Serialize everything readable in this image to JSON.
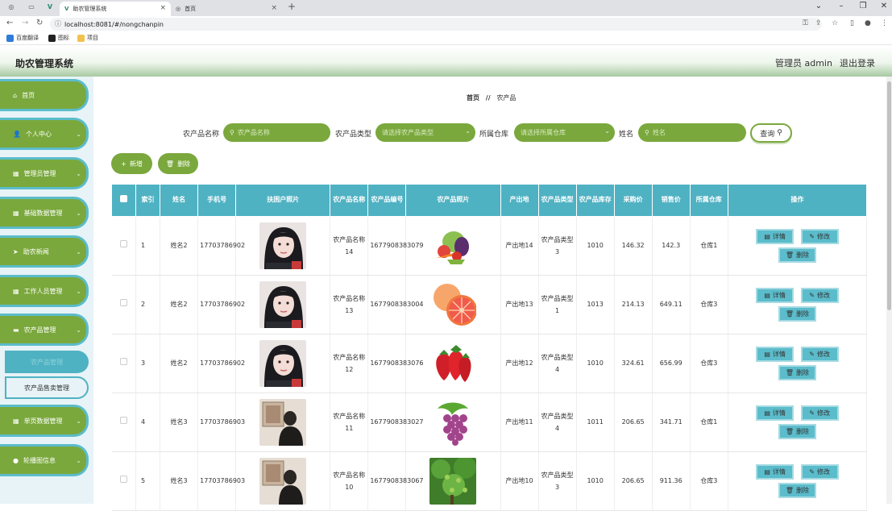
{
  "browser": {
    "tabs": [
      {
        "title": "助农管理系统",
        "active": true
      },
      {
        "title": "首页",
        "active": false
      }
    ],
    "new_tab_icon": "plus-icon",
    "url": "localhost:8081/#/nongchanpin",
    "bookmarks": [
      {
        "label": "百度翻译",
        "color": "#2f7bd9"
      },
      {
        "label": "图标",
        "color": "#222222"
      },
      {
        "label": "项目",
        "color": "#f2c14e"
      }
    ]
  },
  "header": {
    "title": "助农管理系统",
    "user": "管理员 admin",
    "logout": "退出登录"
  },
  "sidebar": {
    "items": [
      {
        "label": "首页",
        "icon": "home-icon",
        "chevron": false
      },
      {
        "label": "个人中心",
        "icon": "user-icon",
        "chevron": true
      },
      {
        "label": "管理员管理",
        "icon": "grid-icon",
        "chevron": true
      },
      {
        "label": "基础数据管理",
        "icon": "grid-icon",
        "chevron": true
      },
      {
        "label": "助农新闻",
        "icon": "send-icon",
        "chevron": true
      },
      {
        "label": "工作人员管理",
        "icon": "grid-icon",
        "chevron": true
      },
      {
        "label": "农产品管理",
        "icon": "briefcase-icon",
        "chevron": true
      },
      {
        "label": "单页数据管理",
        "icon": "grid-icon",
        "chevron": true
      },
      {
        "label": "轮播图信息",
        "icon": "pin-icon",
        "chevron": true
      }
    ],
    "subitems": [
      {
        "label": "农产品管理"
      },
      {
        "label": "农产品售卖管理"
      }
    ]
  },
  "breadcrumb": {
    "home": "首页",
    "separator": "//",
    "current": "农产品"
  },
  "filters": {
    "name_label": "农产品名称",
    "name_placeholder": "农产品名称",
    "type_label": "农产品类型",
    "type_placeholder": "请选择农产品类型",
    "warehouse_label": "所属仓库",
    "warehouse_placeholder": "请选择所属仓库",
    "person_label": "姓名",
    "person_placeholder": "姓名",
    "search_label": "查询"
  },
  "actions": {
    "add": "新增",
    "delete": "删除"
  },
  "table": {
    "headers": [
      "",
      "索引",
      "姓名",
      "手机号",
      "扶困户照片",
      "农产品名称",
      "农产品编号",
      "农产品照片",
      "产出地",
      "农产品类型",
      "农产品库存",
      "采购价",
      "销售价",
      "所属仓库",
      "操作"
    ],
    "row_buttons": {
      "detail": "详情",
      "edit": "修改",
      "delete": "删除"
    },
    "rows": [
      {
        "index": "1",
        "name": "姓名2",
        "phone": "17703786902",
        "person_photo": "woman",
        "product": "农产品名称14",
        "code": "1677908383079",
        "product_photo": "vegetables",
        "origin": "产出地14",
        "type": "农产品类型3",
        "stock": "1010",
        "buy": "146.32",
        "sell": "142.3",
        "warehouse": "仓库1"
      },
      {
        "index": "2",
        "name": "姓名2",
        "phone": "17703786902",
        "person_photo": "woman",
        "product": "农产品名称13",
        "code": "1677908383004",
        "product_photo": "grapefruit",
        "origin": "产出地13",
        "type": "农产品类型1",
        "stock": "1013",
        "buy": "214.13",
        "sell": "649.11",
        "warehouse": "仓库3"
      },
      {
        "index": "3",
        "name": "姓名2",
        "phone": "17703786902",
        "person_photo": "woman",
        "product": "农产品名称12",
        "code": "1677908383076",
        "product_photo": "strawberry",
        "origin": "产出地12",
        "type": "农产品类型4",
        "stock": "1010",
        "buy": "324.61",
        "sell": "656.99",
        "warehouse": "仓库3"
      },
      {
        "index": "4",
        "name": "姓名3",
        "phone": "17703786903",
        "person_photo": "person",
        "product": "农产品名称11",
        "code": "1677908383027",
        "product_photo": "grapes",
        "origin": "产出地11",
        "type": "农产品类型4",
        "stock": "1011",
        "buy": "206.65",
        "sell": "341.71",
        "warehouse": "仓库1"
      },
      {
        "index": "5",
        "name": "姓名3",
        "phone": "17703786903",
        "person_photo": "person",
        "product": "农产品名称10",
        "code": "1677908383067",
        "product_photo": "tree",
        "origin": "产出地10",
        "type": "农产品类型3",
        "stock": "1010",
        "buy": "206.65",
        "sell": "911.36",
        "warehouse": "仓库3"
      }
    ]
  }
}
